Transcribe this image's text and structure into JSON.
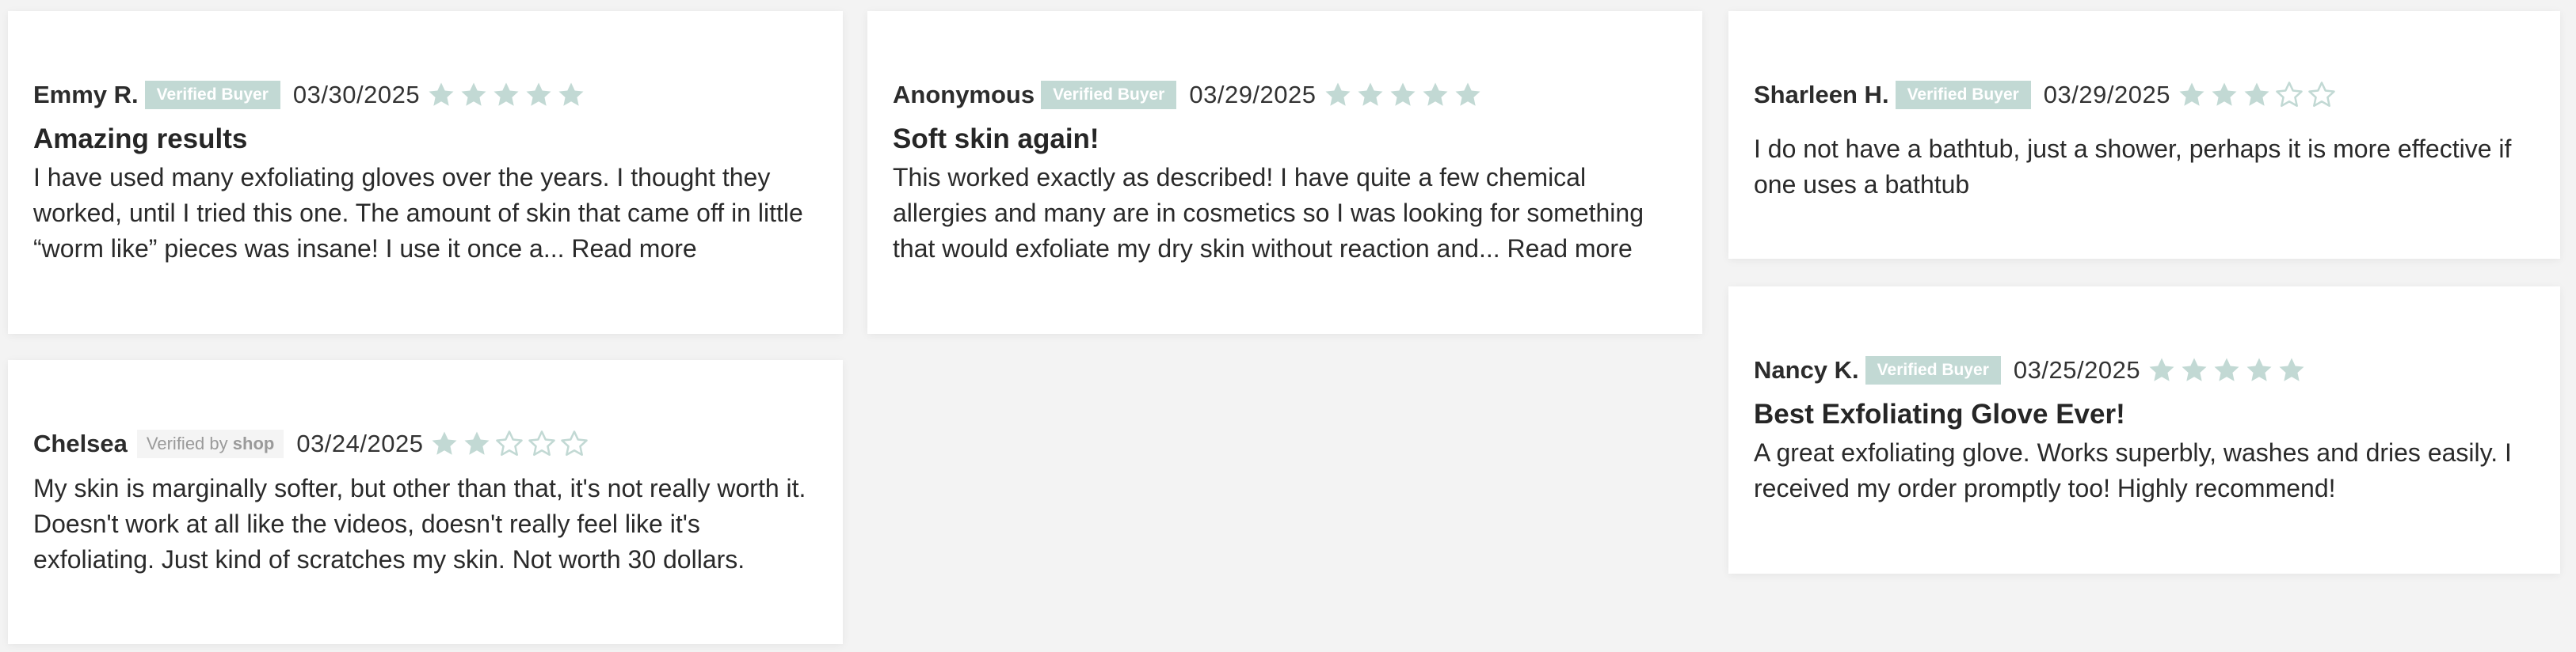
{
  "colors": {
    "badge_bg": "#c2d9d4",
    "star_filled": "#c2d9d4",
    "star_empty_outline": "#c2d9d4",
    "card_bg": "#ffffff",
    "page_bg": "#f3f3f3"
  },
  "icons": {
    "star_filled": "star-filled-icon",
    "star_empty": "star-outline-icon"
  },
  "reviews": [
    {
      "author": "Emmy R.",
      "badge": "Verified Buyer",
      "date": "03/30/2025",
      "rating": 5,
      "title": "Amazing results",
      "body": "I have used many exfoliating gloves over the years. I thought they worked, until I tried this one. The amount of skin that came off in little “worm like” pieces was insane! I use it once a...",
      "read_more": "Read more"
    },
    {
      "author": "Anonymous",
      "badge": "Verified Buyer",
      "date": "03/29/2025",
      "rating": 5,
      "title": "Soft skin again!",
      "body": "This worked exactly as described! I have quite a few chemical allergies and many are in cosmetics so I was looking for something that would exfoliate my dry skin without reaction and...",
      "read_more": "Read more"
    },
    {
      "author": "Sharleen H.",
      "badge": "Verified Buyer",
      "date": "03/29/2025",
      "rating": 3,
      "title": "",
      "body": "I do not have a bathtub, just a shower, perhaps it is more effective if one uses a bathtub",
      "read_more": ""
    },
    {
      "author": "Chelsea",
      "badge_prefix": "Verified by",
      "badge_shop": "shop",
      "date": "03/24/2025",
      "rating": 2,
      "title": "",
      "body": "My skin is marginally softer, but other than that, it's not really worth it. Doesn't work at all like the videos, doesn't really feel like it's exfoliating. Just kind of scratches my skin. Not worth 30 dollars.",
      "read_more": ""
    },
    {
      "author": "Nancy K.",
      "badge": "Verified Buyer",
      "date": "03/25/2025",
      "rating": 5,
      "title": "Best Exfoliating Glove Ever!",
      "body": "A great exfoliating glove. Works superbly, washes and dries easily. I received my order promptly too! Highly recommend!",
      "read_more": ""
    }
  ]
}
